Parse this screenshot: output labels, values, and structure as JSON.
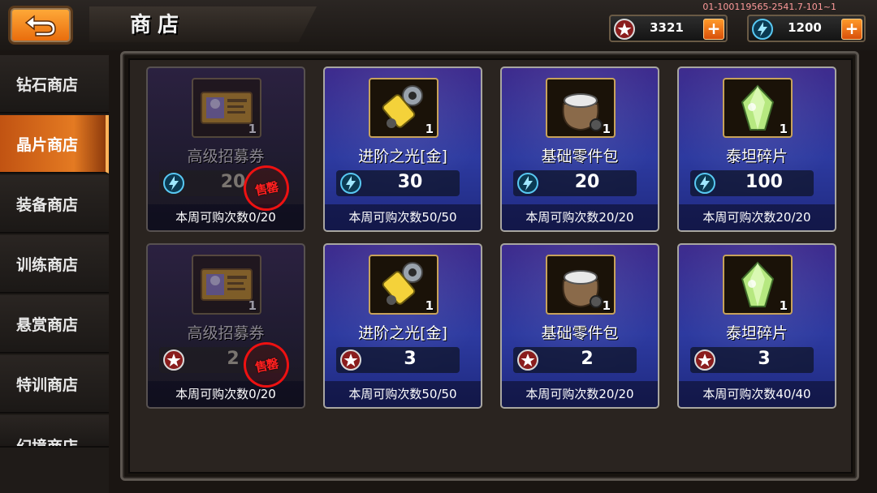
{
  "header": {
    "title": "商店",
    "build_id": "01-100119565-2541.7-101~1",
    "currencies": [
      {
        "icon": "star-medal-icon",
        "value": "3321"
      },
      {
        "icon": "lightning-crystal-icon",
        "value": "1200"
      }
    ]
  },
  "sidebar": {
    "items": [
      {
        "label": "钻石商店",
        "active": false
      },
      {
        "label": "晶片商店",
        "active": true
      },
      {
        "label": "装备商店",
        "active": false
      },
      {
        "label": "训练商店",
        "active": false
      },
      {
        "label": "悬赏商店",
        "active": false
      },
      {
        "label": "特训商店",
        "active": false
      },
      {
        "label": "幻境商店",
        "active": false
      }
    ]
  },
  "shop": {
    "sold_out_label": "售罄",
    "items": [
      {
        "name": "高级招募券",
        "icon": "ticket-icon",
        "qty": "1",
        "price": "20",
        "currency": "lightning-crystal-icon",
        "limit": "本周可购次数0/20",
        "sold_out": true
      },
      {
        "name": "进阶之光[金]",
        "icon": "gold-capsule-icon",
        "qty": "1",
        "price": "30",
        "currency": "lightning-crystal-icon",
        "limit": "本周可购次数50/50",
        "sold_out": false
      },
      {
        "name": "基础零件包",
        "icon": "parts-bag-icon",
        "qty": "1",
        "price": "20",
        "currency": "lightning-crystal-icon",
        "limit": "本周可购次数20/20",
        "sold_out": false
      },
      {
        "name": "泰坦碎片",
        "icon": "titan-shard-icon",
        "qty": "1",
        "price": "100",
        "currency": "lightning-crystal-icon",
        "limit": "本周可购次数20/20",
        "sold_out": false
      },
      {
        "name": "高级招募券",
        "icon": "ticket-icon",
        "qty": "1",
        "price": "2",
        "currency": "star-medal-icon",
        "limit": "本周可购次数0/20",
        "sold_out": true
      },
      {
        "name": "进阶之光[金]",
        "icon": "gold-capsule-icon",
        "qty": "1",
        "price": "3",
        "currency": "star-medal-icon",
        "limit": "本周可购次数50/50",
        "sold_out": false
      },
      {
        "name": "基础零件包",
        "icon": "parts-bag-icon",
        "qty": "1",
        "price": "2",
        "currency": "star-medal-icon",
        "limit": "本周可购次数20/20",
        "sold_out": false
      },
      {
        "name": "泰坦碎片",
        "icon": "titan-shard-icon",
        "qty": "1",
        "price": "3",
        "currency": "star-medal-icon",
        "limit": "本周可购次数40/40",
        "sold_out": false
      }
    ]
  },
  "colors": {
    "accent_orange": "#e47a22",
    "card_blue": "#2d3aa0",
    "card_purple": "#3e2c8e",
    "sold_out_red": "#ff2020"
  }
}
